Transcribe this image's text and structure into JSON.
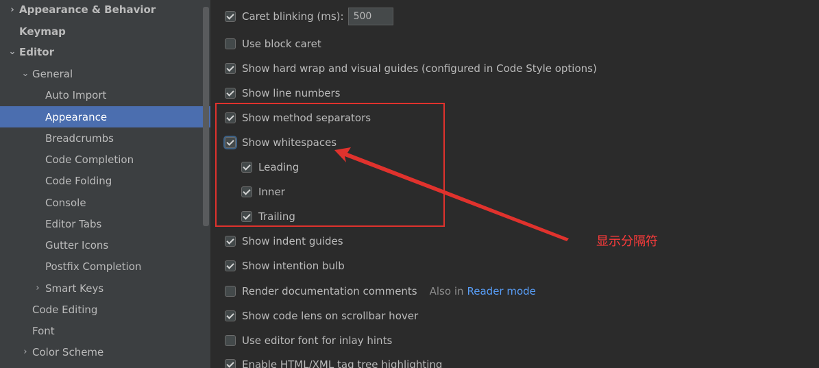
{
  "sidebar": {
    "items": [
      {
        "label": "Appearance & Behavior",
        "arrow": "›"
      },
      {
        "label": "Keymap",
        "arrow": ""
      },
      {
        "label": "Editor",
        "arrow": "⌄"
      },
      {
        "label": "General",
        "arrow": "⌄"
      },
      {
        "label": "Auto Import",
        "arrow": ""
      },
      {
        "label": "Appearance",
        "arrow": ""
      },
      {
        "label": "Breadcrumbs",
        "arrow": ""
      },
      {
        "label": "Code Completion",
        "arrow": ""
      },
      {
        "label": "Code Folding",
        "arrow": ""
      },
      {
        "label": "Console",
        "arrow": ""
      },
      {
        "label": "Editor Tabs",
        "arrow": ""
      },
      {
        "label": "Gutter Icons",
        "arrow": ""
      },
      {
        "label": "Postfix Completion",
        "arrow": ""
      },
      {
        "label": "Smart Keys",
        "arrow": "›"
      },
      {
        "label": "Code Editing",
        "arrow": ""
      },
      {
        "label": "Font",
        "arrow": ""
      },
      {
        "label": "Color Scheme",
        "arrow": "›"
      }
    ]
  },
  "options": {
    "caret_blinking": {
      "label": "Caret blinking (ms):",
      "value": "500",
      "checked": true
    },
    "block_caret": {
      "label": "Use block caret",
      "checked": false
    },
    "hard_wrap": {
      "label": "Show hard wrap and visual guides (configured in Code Style options)",
      "checked": true
    },
    "line_numbers": {
      "label": "Show line numbers",
      "checked": true
    },
    "method_separators": {
      "label": "Show method separators",
      "checked": true
    },
    "whitespaces": {
      "label": "Show whitespaces",
      "checked": true
    },
    "leading": {
      "label": "Leading",
      "checked": true
    },
    "inner": {
      "label": "Inner",
      "checked": true
    },
    "trailing": {
      "label": "Trailing",
      "checked": true
    },
    "indent_guides": {
      "label": "Show indent guides",
      "checked": true
    },
    "intention_bulb": {
      "label": "Show intention bulb",
      "checked": true
    },
    "render_docs": {
      "label": "Render documentation comments",
      "checked": false,
      "note": "Also in",
      "link": "Reader mode"
    },
    "code_lens": {
      "label": "Show code lens on scrollbar hover",
      "checked": true
    },
    "inlay_font": {
      "label": "Use editor font for inlay hints",
      "checked": false
    },
    "tag_tree": {
      "label": "Enable HTML/XML tag tree highlighting",
      "checked": true
    }
  },
  "annotation": {
    "text": "显示分隔符",
    "color": "#ff3b3b"
  },
  "colors": {
    "selection": "#4b6eaf",
    "highlight_box": "#e0322d",
    "link": "#589df6"
  }
}
